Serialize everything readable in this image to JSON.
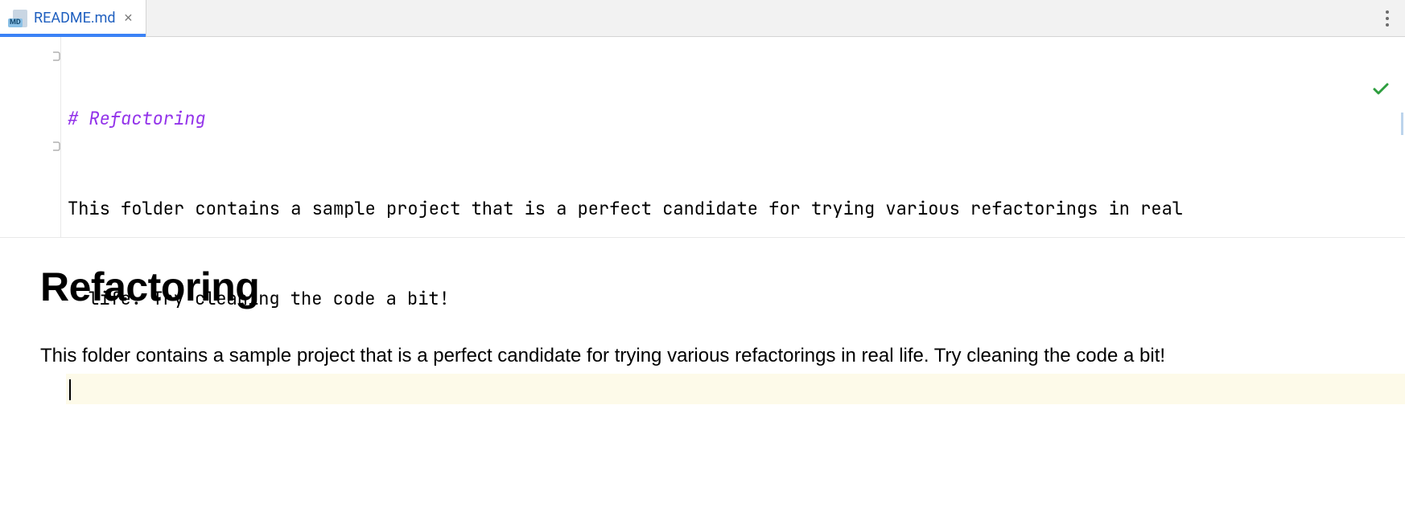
{
  "tabs": {
    "active": {
      "filename": "README.md",
      "icon_badge": "MD"
    }
  },
  "editor": {
    "heading_source": "# Refactoring",
    "body_line1": "This folder contains a sample project that is a perfect candidate for trying various refactorings in real",
    "body_line2": "life. Try cleaning the code a bit!"
  },
  "preview": {
    "heading": "Refactoring",
    "paragraph": "This folder contains a sample project that is a perfect candidate for trying various refactorings in real life. Try cleaning the code a bit!"
  }
}
